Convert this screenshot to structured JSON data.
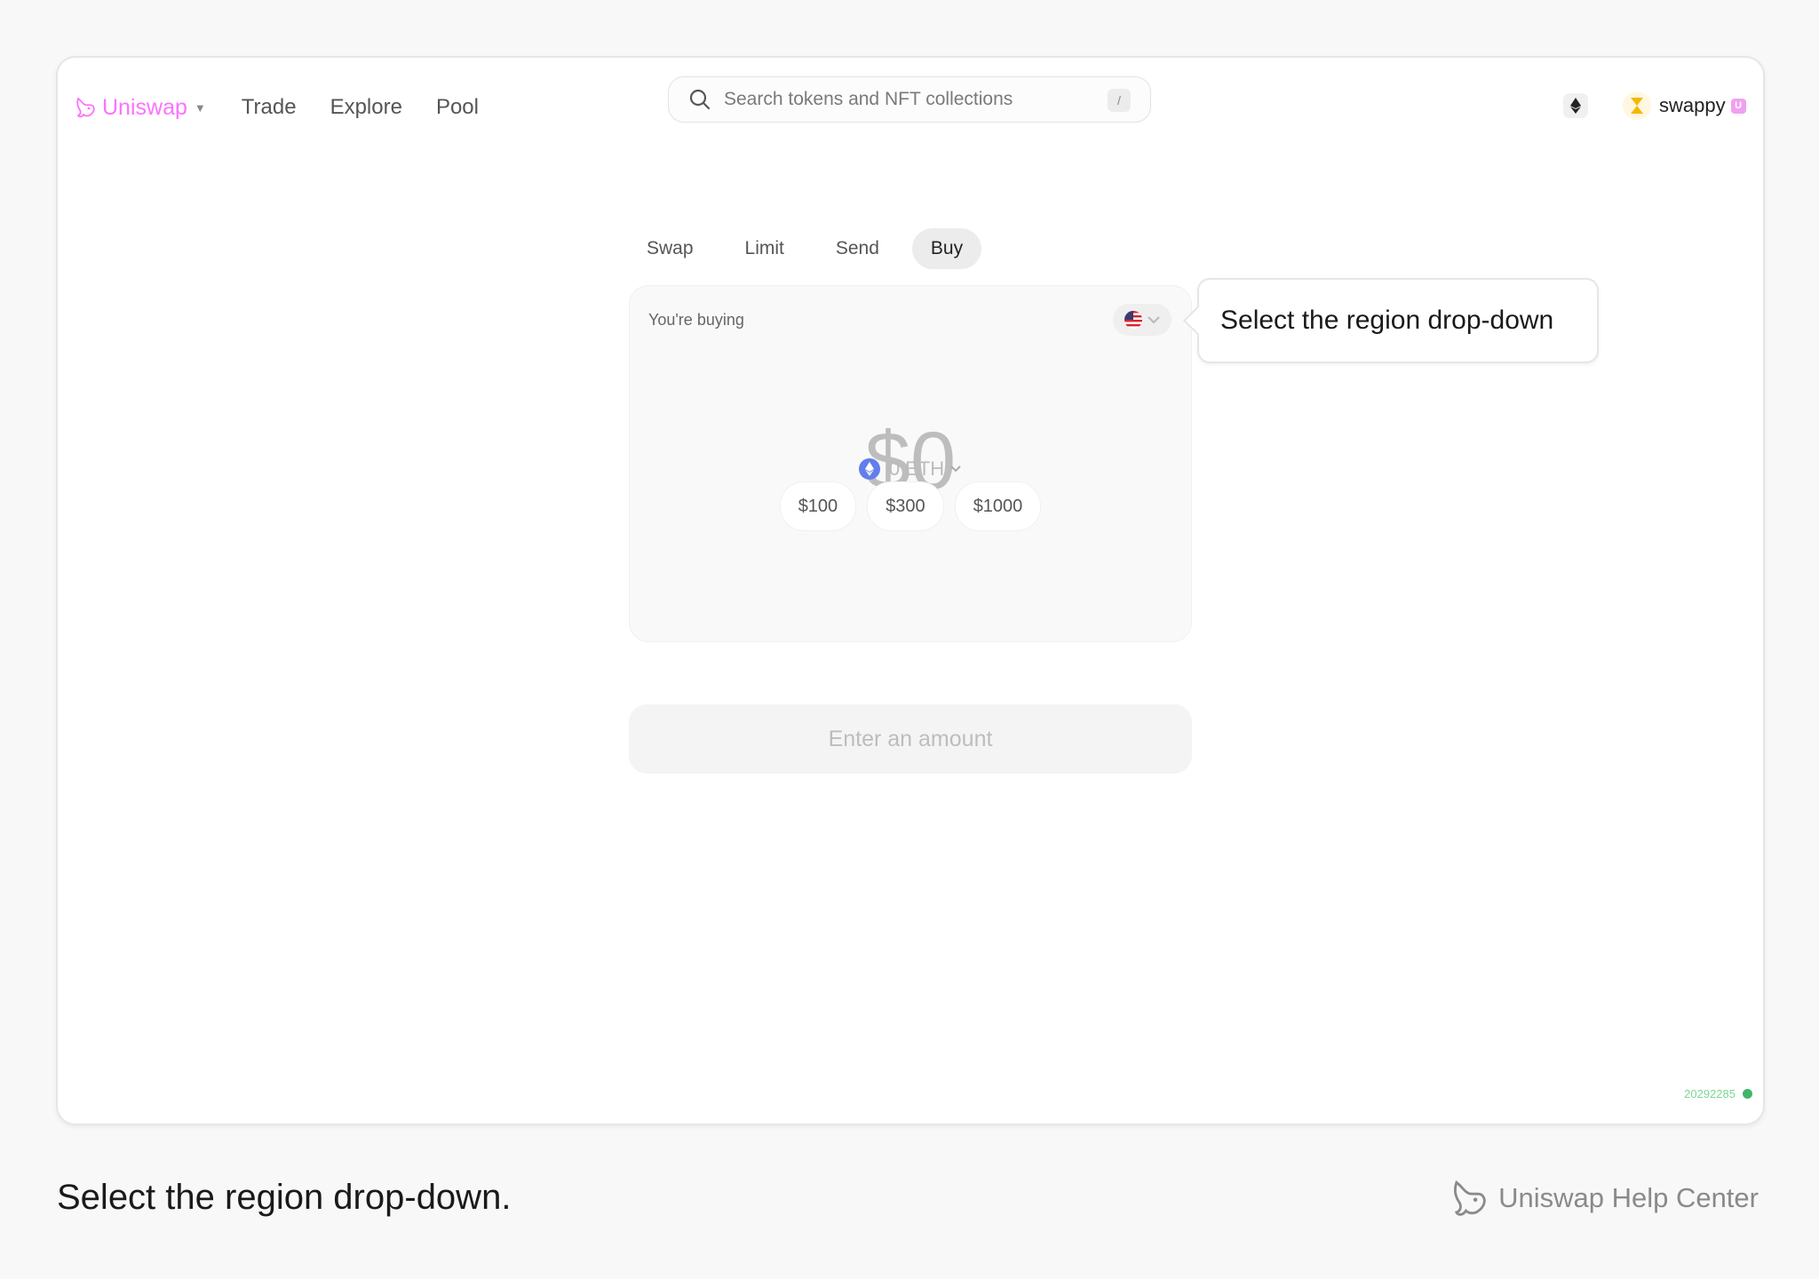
{
  "nav": {
    "brand": "Uniswap",
    "links": [
      "Trade",
      "Explore",
      "Pool"
    ],
    "brand_color": "#fc72ff"
  },
  "search": {
    "placeholder": "Search tokens and NFT collections",
    "shortcut": "/"
  },
  "account": {
    "name": "swappy",
    "badge": "U"
  },
  "tabs": [
    "Swap",
    "Limit",
    "Send",
    "Buy"
  ],
  "active_tab": "Buy",
  "buy": {
    "label": "You're buying",
    "amount": "$0",
    "token_amount": "0 ETH",
    "presets": [
      "$100",
      "$300",
      "$1000"
    ],
    "cta": "Enter an amount",
    "region": "US"
  },
  "tooltip": {
    "text": "Select the region drop-down"
  },
  "version": "20292285",
  "caption": "Select the region drop-down.",
  "help_center": "Uniswap Help Center"
}
